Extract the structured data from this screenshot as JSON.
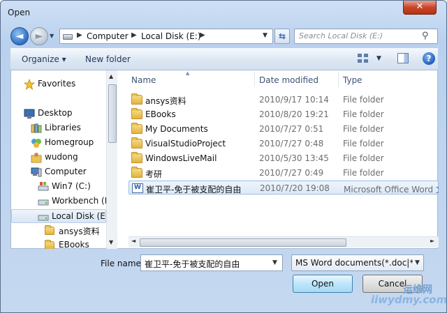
{
  "window": {
    "title": "Open",
    "close_glyph": "✕"
  },
  "nav": {
    "back_glyph": "◄",
    "forward_glyph": "►",
    "history_glyph": "▼",
    "breadcrumb": [
      "Computer",
      "Local Disk (E:)"
    ],
    "crumb_separator": "▶",
    "address_dropdown": "▼",
    "refresh_glyph": "⇆",
    "search_placeholder": "Search Local Disk (E:)",
    "search_icon": "⚲"
  },
  "toolbar": {
    "organize_label": "Organize ▾",
    "new_folder_label": "New folder",
    "view_dropdown": "▼",
    "help_glyph": "?"
  },
  "navigation_tree": [
    {
      "label": "Favorites",
      "icon": "star-icon",
      "level": 0
    },
    {
      "label": "Desktop",
      "icon": "desktop-icon",
      "level": 0
    },
    {
      "label": "Libraries",
      "icon": "libraries-icon",
      "level": 1
    },
    {
      "label": "Homegroup",
      "icon": "homegroup-icon",
      "level": 1
    },
    {
      "label": "wudong",
      "icon": "user-folder-icon",
      "level": 1
    },
    {
      "label": "Computer",
      "icon": "computer-icon",
      "level": 1
    },
    {
      "label": "Win7 (C:)",
      "icon": "windows-drive-icon",
      "level": 2
    },
    {
      "label": "Workbench (D",
      "icon": "drive-icon",
      "level": 2
    },
    {
      "label": "Local Disk (E:)",
      "icon": "drive-icon",
      "level": 2,
      "selected": true
    },
    {
      "label": "ansys资料",
      "icon": "folder-icon",
      "level": 3
    },
    {
      "label": "EBooks",
      "icon": "folder-icon",
      "level": 3
    }
  ],
  "file_list": {
    "columns": [
      "Name",
      "Date modified",
      "Type"
    ],
    "sort_indicator": "▲",
    "rows": [
      {
        "name": "ansys资料",
        "date": "2010/9/17 10:14",
        "type": "File folder",
        "icon": "folder-icon"
      },
      {
        "name": "EBooks",
        "date": "2010/8/20 19:21",
        "type": "File folder",
        "icon": "folder-icon"
      },
      {
        "name": "My Documents",
        "date": "2010/7/27 0:51",
        "type": "File folder",
        "icon": "folder-icon"
      },
      {
        "name": "VisualStudioProject",
        "date": "2010/7/27 0:48",
        "type": "File folder",
        "icon": "folder-icon"
      },
      {
        "name": "WindowsLiveMail",
        "date": "2010/5/30 13:45",
        "type": "File folder",
        "icon": "folder-icon"
      },
      {
        "name": "考研",
        "date": "2010/7/27 0:49",
        "type": "File folder",
        "icon": "folder-icon"
      },
      {
        "name": "崔卫平-免于被支配的自由",
        "date": "2010/7/20 19:08",
        "type": "Microsoft Office Word 文",
        "icon": "word-document-icon",
        "selected": true
      }
    ]
  },
  "scroll": {
    "up": "▲",
    "down": "▼",
    "left": "◄",
    "right": "►"
  },
  "footer": {
    "file_name_label": "File name:",
    "file_name_value": "崔卫平-免于被支配的自由",
    "file_name_dropdown": "▼",
    "file_type_value": "MS Word documents(*.doc|*.do",
    "file_type_dropdown": "▼",
    "open_label": "Open",
    "cancel_label": "Cancel"
  },
  "watermark": {
    "cn": "运维网",
    "en": "iiwydmy.com"
  }
}
